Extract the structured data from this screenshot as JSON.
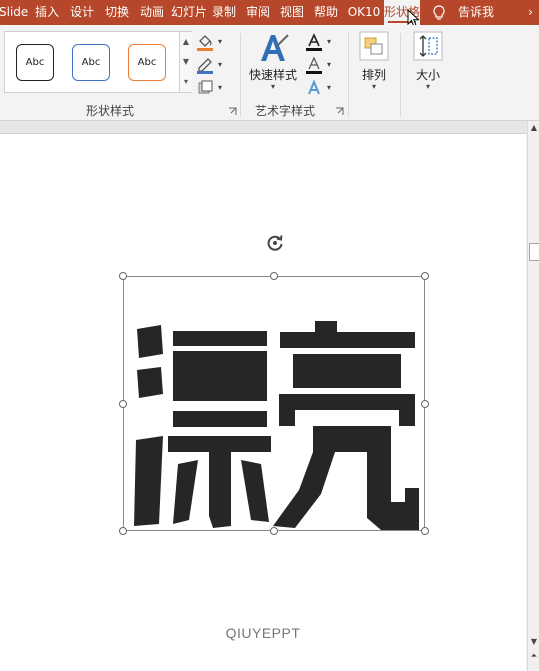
{
  "tabs": [
    {
      "label": "iSlide",
      "active": false
    },
    {
      "label": "插入",
      "active": false
    },
    {
      "label": "设计",
      "active": false
    },
    {
      "label": "切换",
      "active": false
    },
    {
      "label": "动画",
      "active": false
    },
    {
      "label": "幻灯片",
      "active": false
    },
    {
      "label": "录制",
      "active": false
    },
    {
      "label": "审阅",
      "active": false
    },
    {
      "label": "视图",
      "active": false
    },
    {
      "label": "帮助",
      "active": false
    },
    {
      "label": "OK10",
      "active": false
    },
    {
      "label": "形状格式",
      "active": true
    }
  ],
  "tell_me": {
    "label": "告诉我",
    "icon": "lightbulb-icon"
  },
  "ribbon": {
    "shape_styles": {
      "label": "形状样式",
      "presets": [
        {
          "text": "Abc",
          "border": "#222222"
        },
        {
          "text": "Abc",
          "border": "#4472c4"
        },
        {
          "text": "Abc",
          "border": "#ed7d31"
        }
      ],
      "fill_color": "#ed7d31",
      "outline_color": "#4472c4"
    },
    "wordart_styles": {
      "label": "艺术字样式",
      "quick_styles": "快速样式",
      "text_fill_icon": "text-fill-icon",
      "text_outline_icon": "text-outline-icon",
      "text_effects_icon": "text-effects-icon"
    },
    "arrange": {
      "label": "排列"
    },
    "size": {
      "label": "大小"
    }
  },
  "slide": {
    "wordart_text": "漂亮",
    "wordart_color": "#262626",
    "footer": "QIUYEPPT"
  },
  "colors": {
    "accent": "#b7472a"
  }
}
